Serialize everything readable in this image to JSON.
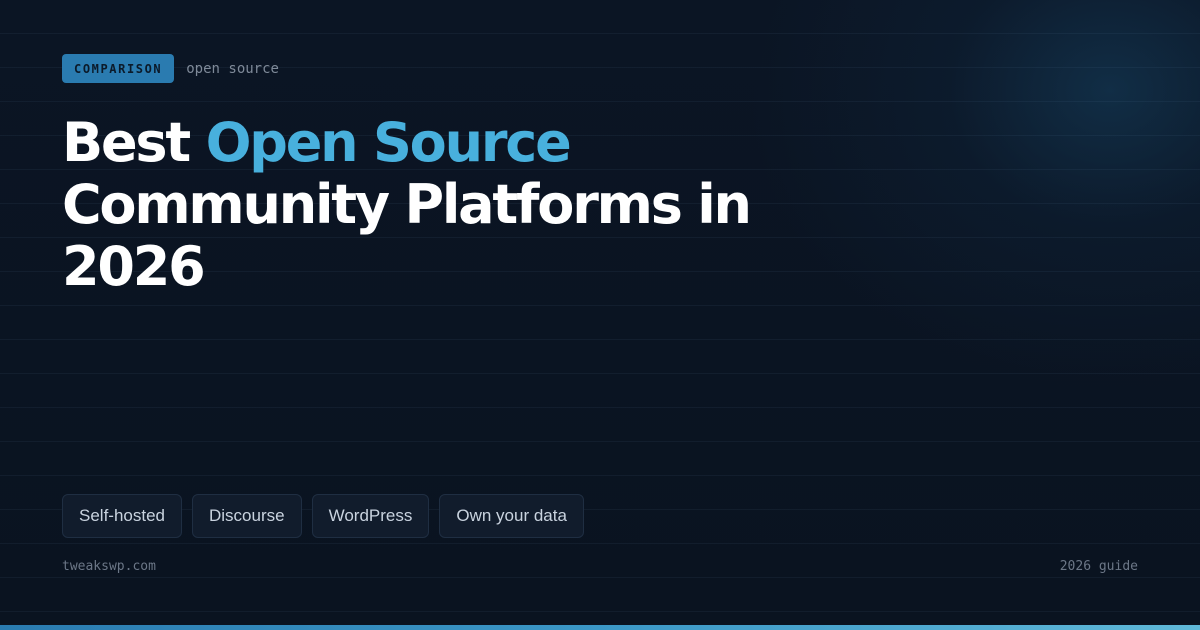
{
  "eyebrow": {
    "badge": "COMPARISON",
    "label": "open source"
  },
  "headline": {
    "lead": "Best",
    "accent": "Open Source",
    "rest": "Community Platforms in 2026"
  },
  "tags": [
    {
      "label": "Self-hosted"
    },
    {
      "label": "Discourse"
    },
    {
      "label": "WordPress"
    },
    {
      "label": "Own your data"
    }
  ],
  "footer": {
    "site": "tweakswp.com",
    "note": "2026 guide"
  },
  "colors": {
    "background": "#0b1422",
    "accent": "#48b0dd",
    "badge": "#2a7bb0",
    "text": "#ffffff"
  }
}
